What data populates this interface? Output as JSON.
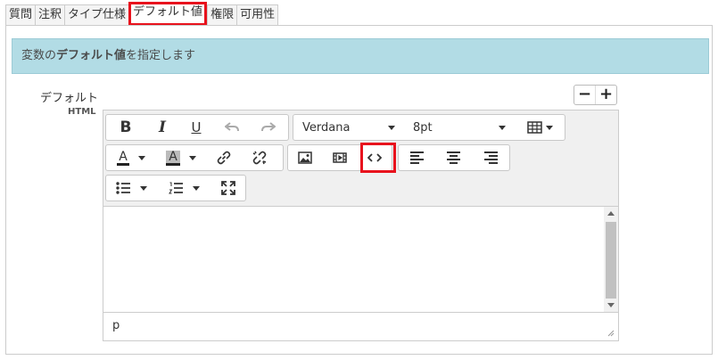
{
  "tabs": [
    {
      "label": "質問"
    },
    {
      "label": "注釈"
    },
    {
      "label": "タイプ仕様"
    },
    {
      "label": "デフォルト値"
    },
    {
      "label": "権限"
    },
    {
      "label": "可用性"
    }
  ],
  "info": {
    "prefix": "変数の",
    "bold": "デフォルト値",
    "suffix": "を指定します"
  },
  "field": {
    "label": "デフォルト",
    "sublabel": "HTML"
  },
  "stepper": {
    "minus": "−",
    "plus": "+"
  },
  "editor": {
    "font_family": "Verdana",
    "font_size": "8pt",
    "status_path": "p"
  },
  "colors": {
    "highlight": "#e8121d",
    "info_bg": "#b2dce5"
  }
}
